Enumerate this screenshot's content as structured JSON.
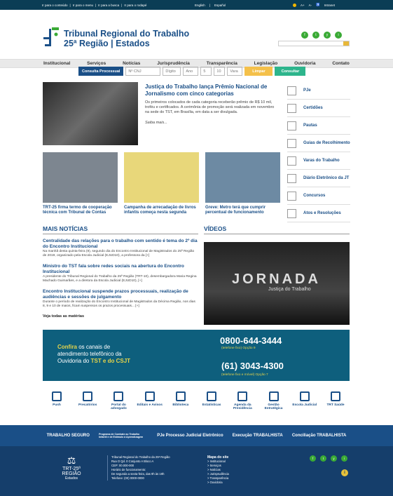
{
  "topbar": {
    "skip": [
      "Ir para o conteúdo",
      "Ir para o menu",
      "Ir para a busca",
      "Ir para o rodapé"
    ],
    "lang": [
      "English",
      "Español"
    ],
    "acc": [
      "A+",
      "A-",
      "Intranet"
    ]
  },
  "logo": {
    "line1": "Tribunal Regional do Trabalho",
    "line2": "25ª Região | Estados"
  },
  "social": [
    "f",
    "t",
    "y",
    "i"
  ],
  "nav": [
    "Institucional",
    "Serviços",
    "Notícias",
    "Jurisprudência",
    "Transparência",
    "Legislação",
    "Ouvidoria",
    "Contato"
  ],
  "consulta": {
    "label": "Consulta Processual",
    "fields": [
      "Nº CNJ",
      "Dígito",
      "Ano",
      "5",
      "10",
      "Vara"
    ],
    "clear": "Limpar",
    "go": "Consultar"
  },
  "featured": {
    "title": "Justiça do Trabalho lança Prêmio Nacional de Jornalismo com cinco categorias",
    "text": "Os primeiros colocados de cada categoria receberão prêmio de R$ 10 mil, troféu e certificados. A cerimônia de promoção será realizada em novembro na sede do TST, em Brasília, em data a ser divulgada.",
    "more": "Saiba mais..."
  },
  "side": [
    "PJe",
    "Certidões",
    "Pautas",
    "Guias de Recolhimento",
    "Varas do Trabalho",
    "Diário Eletrônico da JT",
    "Concursos",
    "Atos e Resoluções"
  ],
  "thumbs": [
    {
      "title": "TRT-25 firma termo de cooperação técnica com Tribunal de Contas",
      "color": "#7d8690"
    },
    {
      "title": "Campanha de arrecadação de livros infantis começa nesta segunda",
      "color": "#e8d77a"
    },
    {
      "title": "Greve: Metro terá que cumprir percentual de funcionamento",
      "color": "#6d8aa3"
    }
  ],
  "news_title": "MAIS NOTÍCIAS",
  "news": [
    {
      "title": "Centralidade das relações para o trabalho com sentido é tema do 2º dia do Encontro Institucional",
      "text": "Na manhã desta quinta-feira (9), segundo dia do Encontro Institucional de Magistrados do 25ª Região de 2019, organizado pela Escola Judicial (EJUD10), a professora da [+]"
    },
    {
      "title": "Ministro do TST fala sobre redes sociais na abertura do Encontro Institucional",
      "text": "A presidente do Tribunal Regional do Trabalho da 25ª Região (TRT-10), desembargadora Maria Regina Machado Guimarães, e a diretora da Escola Judicial (EJUD10), [+]"
    },
    {
      "title": "Encontro Institucional suspende prazos processuais, realização de audiências e sessões de julgamento",
      "text": "Durante o período de realização do Encontro Institucional de Magistrados da Décima Região, nos dias 8, 9 e 10 de maios, ficam suspensos os prazos processuais... [+]"
    }
  ],
  "news_more": "Veja todas as matérias",
  "video_title": "VÍDEOS",
  "video": {
    "title": "JORNADA",
    "sub": "Justiça do Trabalho"
  },
  "banner": {
    "l1": "Confira",
    "l2": "os canais de",
    "l3": "atendimento telefônico da",
    "l4": "Ouvidoria do",
    "l5": "TST e do CSJT",
    "p1": "0800-644-3444",
    "n1": "(telefone fixo) Opção 9",
    "p2": "(61) 3043-4300",
    "n2": "(telefone fixo e móvel) Opção 7"
  },
  "icons": [
    "Push",
    "Precatórios",
    "Portal do advogado",
    "Editais e Avisos",
    "Biblioteca",
    "Estatísticas",
    "Agenda da Presidência",
    "Gestão Estratégica",
    "Escola Judicial",
    "TRT Saúde"
  ],
  "partners": [
    "TRABALHO SEGURO",
    "Programa de Combate ao Trabalho Infantil e de Estímulo à Aprendizagem",
    "PJe Processo Judicial Eletrônico",
    "Execução TRABALHISTA",
    "Conciliação TRABALHISTA"
  ],
  "footer": {
    "logo": "TRT-25ª REGIÃO",
    "logo2": "Estados",
    "info": [
      "Tribunal Regional do Trabalho da 25ª Região",
      "Rua O Qd. 0 Conjunto A Bloco A",
      "CEP: 00.000-000",
      "Horário de funcionamento:",
      "De segunda a sexta-feira, das 9h às 19h",
      "Telefone: (00) 0000-0000"
    ],
    "map_title": "Mapa do site",
    "map": [
      "> Institucional",
      "> Serviços",
      "> Notícias",
      "> Jurisprudência",
      "> Transparência",
      "> Ouvidoria"
    ]
  }
}
